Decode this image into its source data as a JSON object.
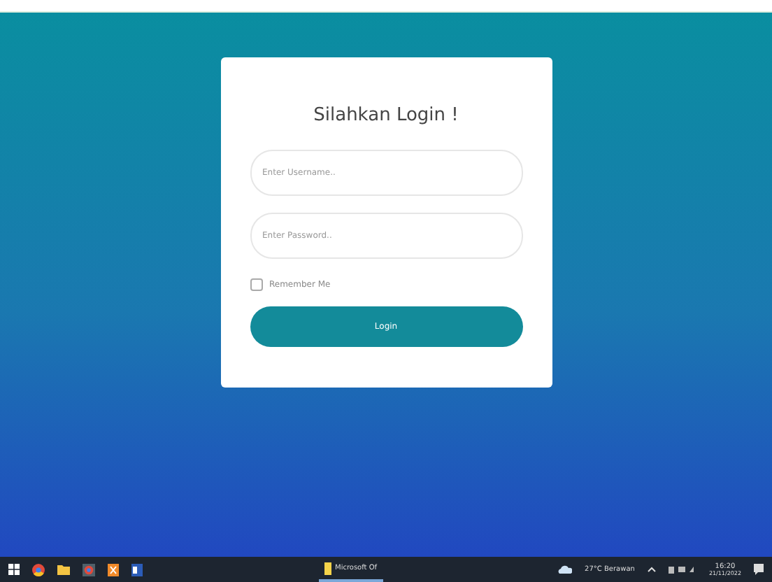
{
  "login": {
    "title": "Silahkan Login !",
    "username": {
      "placeholder": "Enter Username.."
    },
    "password": {
      "placeholder": "Enter Password.."
    },
    "remember": {
      "label": "Remember Me",
      "checked": false
    },
    "button": "Login"
  },
  "taskbar": {
    "apps": [
      {
        "kind": "windows"
      },
      {
        "kind": "browser"
      },
      {
        "kind": "folder"
      },
      {
        "kind": "browser-alt"
      },
      {
        "kind": "xampp"
      },
      {
        "kind": "word"
      }
    ],
    "window_button": "Microsoft Of",
    "weather": "27°C Berawan",
    "time": "16:20",
    "date": "21/11/2022"
  }
}
